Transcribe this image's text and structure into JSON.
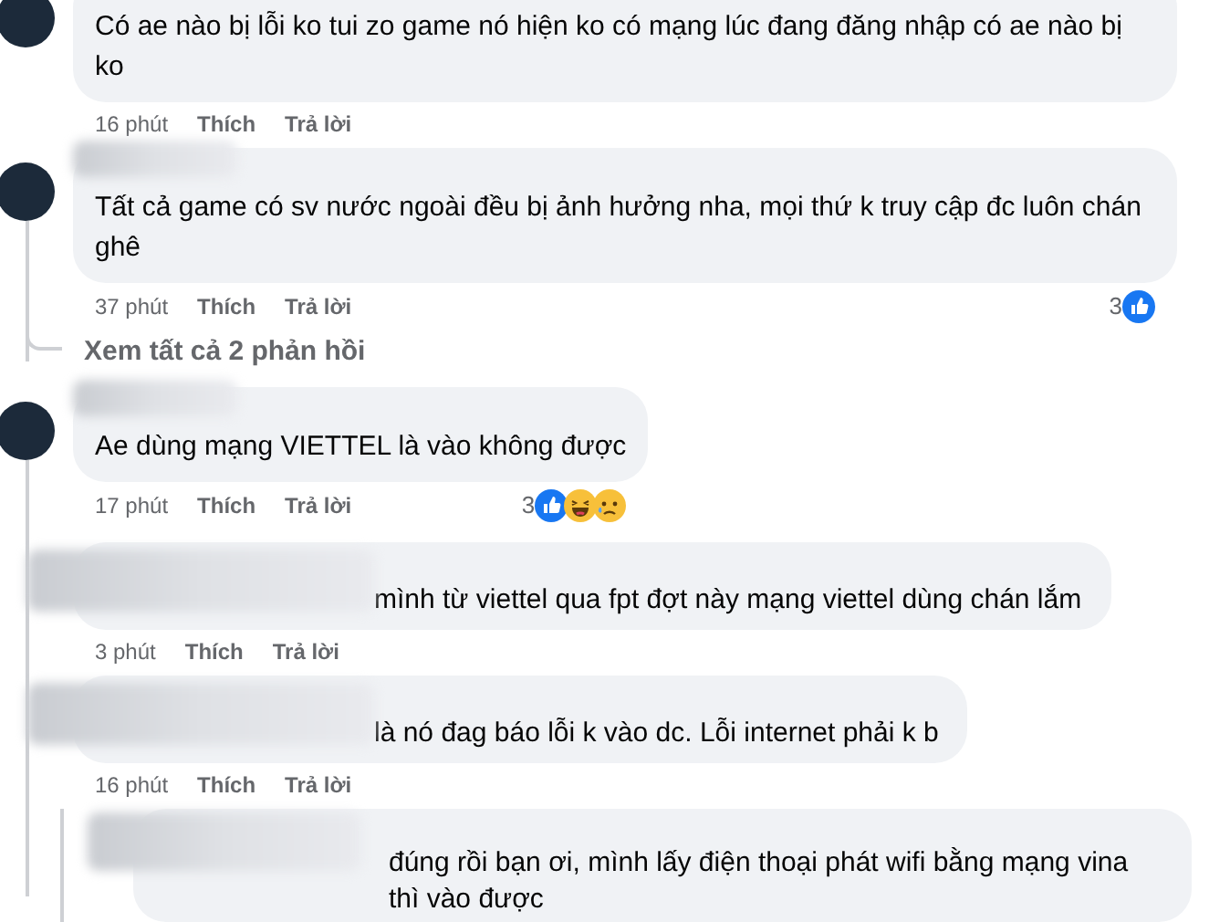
{
  "comments": [
    {
      "text": "Có ae nào bị lỗi ko tui zo game nó hiện ko có mạng lúc đang đăng nhập có ae nào bị ko",
      "time": "16 phút",
      "like": "Thích",
      "reply": "Trả lời"
    },
    {
      "text": "Tất cả game có sv nước ngoài đều bị ảnh hưởng nha, mọi thứ k truy cập đc luôn chán ghê",
      "time": "37 phút",
      "like": "Thích",
      "reply": "Trả lời",
      "reaction_count": "3",
      "reactions": [
        {
          "kind": "like"
        }
      ],
      "view_replies": "Xem tất cả 2 phản hồi"
    },
    {
      "text": "Ae dùng mạng VIETTEL là vào không được",
      "time": "17 phút",
      "like": "Thích",
      "reply": "Trả lời",
      "reaction_count": "3",
      "reactions": [
        {
          "kind": "like"
        },
        {
          "kind": "haha"
        },
        {
          "kind": "sad"
        }
      ],
      "children": [
        {
          "text": "mình từ viettel qua fpt đợt này mạng viettel dùng chán lắm",
          "time": "3 phút",
          "like": "Thích",
          "reply": "Trả lời"
        },
        {
          "text": "là nó đag báo lỗi k vào dc. Lỗi internet phải k b",
          "time": "16 phút",
          "like": "Thích",
          "reply": "Trả lời",
          "children": [
            {
              "text": "đúng rồi bạn ơi, mình lấy điện thoại phát wifi bằng mạng vina thì vào được"
            }
          ]
        }
      ]
    }
  ]
}
